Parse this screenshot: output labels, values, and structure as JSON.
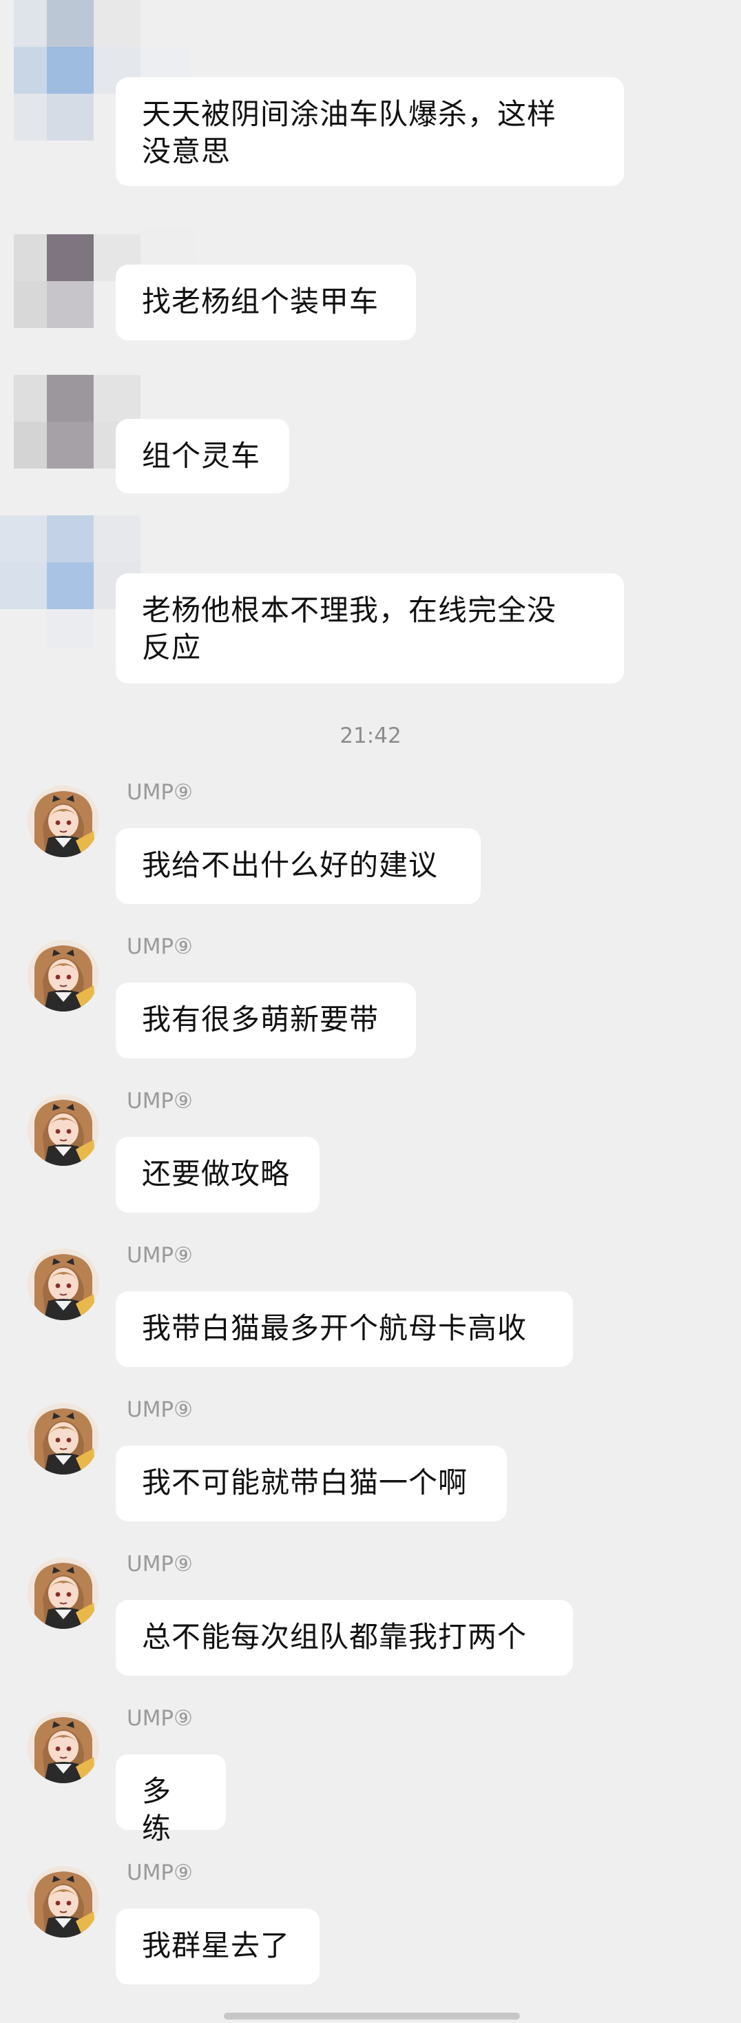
{
  "messages_top": [
    {
      "lines": [
        "天天被阴间涂油车队爆杀，这样",
        "没意思"
      ]
    },
    {
      "lines": [
        "找老杨组个装甲车"
      ]
    },
    {
      "lines": [
        "组个灵车"
      ]
    },
    {
      "lines": [
        "老杨他根本不理我，在线完全没",
        "反应"
      ]
    }
  ],
  "timestamp": "21:42",
  "sender_name": "UMP⑨",
  "messages_ump": [
    "我给不出什么好的建议",
    "我有很多萌新要带",
    "还要做攻略",
    "我带白猫最多开个航母卡高收",
    "我不可能就带白猫一个啊",
    "总不能每次组队都靠我打两个",
    "多练",
    "我群星去了"
  ],
  "colors": {
    "background": "#efefef",
    "bubble": "#ffffff",
    "text": "#111111",
    "meta_text": "#9a9a9a"
  }
}
